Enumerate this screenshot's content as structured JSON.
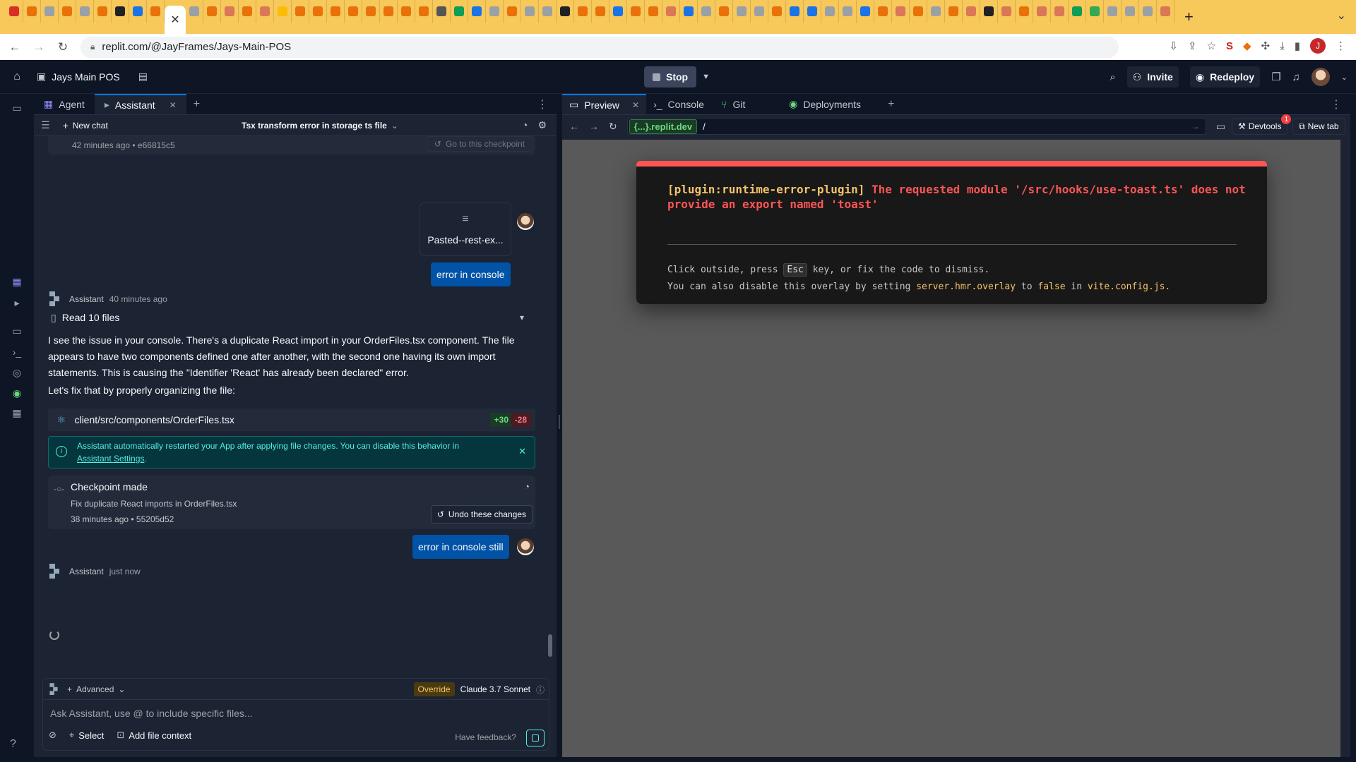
{
  "browser": {
    "url": "replit.com/@JayFrames/Jays-Main-POS",
    "profile_initial": "J",
    "tab_colors": [
      "#d93025",
      "#e8710a",
      "#9aa0a6",
      "#e8710a",
      "#9aa0a6",
      "#e8710a",
      "#202124",
      "#1a73e8",
      "#e8710a",
      "#9aa0a6",
      "#e8710a",
      "#d97757",
      "#e8710a",
      "#d97757",
      "#fbbc04",
      "#e8710a",
      "#e8710a",
      "#e8710a",
      "#e8710a",
      "#e8710a",
      "#e8710a",
      "#e8710a",
      "#e8710a",
      "#555555",
      "#0f9d58",
      "#1a73e8",
      "#9aa0a6",
      "#e8710a",
      "#9aa0a6",
      "#9aa0a6",
      "#202124",
      "#e8710a",
      "#e8710a",
      "#1a73e8",
      "#e8710a",
      "#e8710a",
      "#d97757",
      "#1a73e8",
      "#9aa0a6",
      "#e8710a",
      "#9aa0a6",
      "#9aa0a6",
      "#e8710a",
      "#1a73e8",
      "#1a73e8",
      "#9aa0a6",
      "#9aa0a6",
      "#1a73e8",
      "#e8710a",
      "#d97757",
      "#e8710a",
      "#9aa0a6",
      "#e8710a",
      "#d97757",
      "#202124",
      "#d97757",
      "#e8710a",
      "#d97757",
      "#d97757",
      "#0f9d58",
      "#34a853",
      "#9aa0a6",
      "#9aa0a6",
      "#9aa0a6",
      "#d97757"
    ]
  },
  "topbar": {
    "project_name": "Jays Main POS",
    "stop_label": "Stop",
    "invite_label": "Invite",
    "redeploy_label": "Redeploy"
  },
  "left_tabs": {
    "agent": "Agent",
    "assistant": "Assistant"
  },
  "chatbar": {
    "new_chat": "New chat",
    "title": "Tsx transform error in storage ts file"
  },
  "chat": {
    "top_checkpoint_meta": "42 minutes ago  • e66815c5",
    "goto_checkpoint": "Go to this checkpoint",
    "attachment_name": "Pasted--rest-ex...",
    "user_msg_1": "error in console",
    "assistant_name": "Assistant",
    "assistant_time_1": "40 minutes ago",
    "read_files": "Read 10 files",
    "para_1": "I see the issue in your console. There's a duplicate React import in your OrderFiles.tsx component. The file appears to have two components defined one after another, with the second one having its own import statements. This is causing the \"Identifier 'React' has already been declared\" error.",
    "para_2": "Let's fix that by properly organizing the file:",
    "diff_file": "client/src/components/OrderFiles.tsx",
    "diff_added": "+30",
    "diff_removed": "-28",
    "info_text": "Assistant automatically restarted your App after applying file changes. You can disable this behavior in",
    "info_link": "Assistant Settings",
    "checkpoint_title": "Checkpoint made",
    "checkpoint_desc": "Fix duplicate React imports in OrderFiles.tsx",
    "checkpoint_meta": "38 minutes ago  • 55205d52",
    "undo_label": "Undo these changes",
    "user_msg_2": "error in console still",
    "assistant_time_2": "just now"
  },
  "composer": {
    "advanced_label": "Advanced",
    "override_label": "Override",
    "model_label": "Claude 3.7 Sonnet",
    "placeholder": "Ask Assistant, use @ to include specific files...",
    "select_label": "Select",
    "add_context_label": "Add file context",
    "feedback_label": "Have feedback?"
  },
  "right_tabs": {
    "preview": "Preview",
    "console": "Console",
    "git": "Git",
    "deployments": "Deployments"
  },
  "preview_bar": {
    "domain": "{...}.replit.dev",
    "path": "/",
    "devtools_label": "Devtools",
    "devtools_badge": "1",
    "newtab_label": "New tab"
  },
  "error_overlay": {
    "plugin": "[plugin:runtime-error-plugin]",
    "message": "The requested module '/src/hooks/use-toast.ts' does not provide an export named 'toast'",
    "tip_1_a": "Click outside, press",
    "tip_1_key": "Esc",
    "tip_1_b": "key, or fix the code to dismiss.",
    "tip_2_a": "You can also disable this overlay by setting",
    "tip_2_setting": "server.hmr.overlay",
    "tip_2_to": "to",
    "tip_2_false": "false",
    "tip_2_in": "in",
    "tip_2_file": "vite.config.js."
  }
}
